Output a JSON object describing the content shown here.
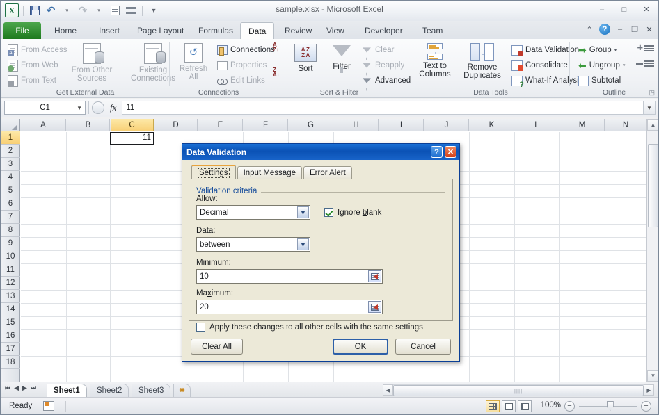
{
  "window": {
    "title": "sample.xlsx  -  Microsoft Excel",
    "minimize": "–",
    "restore": "□",
    "close": "✕"
  },
  "quick_access": {
    "logo": "X",
    "save": "save-icon",
    "undo": "↶",
    "redo": "↷",
    "customize": "▾"
  },
  "ribbon_tabs": [
    {
      "label": "File",
      "active": false,
      "file": true
    },
    {
      "label": "Home",
      "active": false
    },
    {
      "label": "Insert",
      "active": false
    },
    {
      "label": "Page Layout",
      "active": false
    },
    {
      "label": "Formulas",
      "active": false
    },
    {
      "label": "Data",
      "active": true
    },
    {
      "label": "Review",
      "active": false
    },
    {
      "label": "View",
      "active": false
    },
    {
      "label": "Developer",
      "active": false
    },
    {
      "label": "Team",
      "active": false
    }
  ],
  "ribbon_right": {
    "collapse": "⌃",
    "help": "?",
    "minimize": "–",
    "restore": "❐",
    "close": "✕"
  },
  "ribbon_groups": {
    "get_external_data": {
      "label": "Get External Data",
      "items": [
        "From Access",
        "From Web",
        "From Text",
        "From Other Sources",
        "Existing Connections"
      ]
    },
    "connections": {
      "label": "Connections",
      "refresh_all": "Refresh All",
      "items": [
        "Connections",
        "Properties",
        "Edit Links"
      ]
    },
    "sort_filter": {
      "label": "Sort & Filter",
      "sort": "Sort",
      "filter": "Filter",
      "items": [
        "Clear",
        "Reapply",
        "Advanced"
      ]
    },
    "data_tools": {
      "label": "Data Tools",
      "text_to_columns": "Text to Columns",
      "remove_duplicates": "Remove Duplicates",
      "items": [
        "Data Validation",
        "Consolidate",
        "What-If Analysis"
      ]
    },
    "outline": {
      "label": "Outline",
      "items": [
        "Group",
        "Ungroup",
        "Subtotal"
      ]
    }
  },
  "formula_bar": {
    "name_box": "C1",
    "fx": "fx",
    "value": "11"
  },
  "grid": {
    "columns": [
      "A",
      "B",
      "C",
      "D",
      "E",
      "F",
      "G",
      "H",
      "I",
      "J",
      "K",
      "L",
      "M",
      "N"
    ],
    "selected_column": "C",
    "rows": [
      "1",
      "2",
      "3",
      "4",
      "5",
      "6",
      "7",
      "8",
      "9",
      "10",
      "11",
      "12",
      "13",
      "14",
      "15",
      "16",
      "17",
      "18"
    ],
    "selected_row": "1",
    "active_cell": {
      "ref": "C1",
      "value": "11"
    }
  },
  "sheet_tabs": {
    "nav": [
      "⏮",
      "◀",
      "▶",
      "⏭"
    ],
    "tabs": [
      "Sheet1",
      "Sheet2",
      "Sheet3"
    ],
    "active": "Sheet1",
    "new_sheet": "new-sheet-icon"
  },
  "status_bar": {
    "mode": "Ready",
    "zoom": "100%",
    "zoom_out": "−",
    "zoom_in": "+",
    "views": [
      "normal-view",
      "page-layout-view",
      "page-break-view"
    ],
    "active_view": "normal-view"
  },
  "dialog": {
    "title": "Data Validation",
    "help_button": "?",
    "close_button": "✕",
    "tabs": [
      {
        "label": "Settings",
        "active": true
      },
      {
        "label": "Input Message",
        "active": false
      },
      {
        "label": "Error Alert",
        "active": false
      }
    ],
    "legend": "Validation criteria",
    "allow_label": "Allow:",
    "allow_value": "Decimal",
    "ignore_blank_label": "Ignore blank",
    "ignore_blank_checked": true,
    "data_label": "Data:",
    "data_value": "between",
    "minimum_label": "Minimum:",
    "minimum_value": "10",
    "maximum_label": "Maximum:",
    "maximum_value": "20",
    "apply_all_label": "Apply these changes to all other cells with the same settings",
    "apply_all_checked": false,
    "clear_all": "Clear All",
    "ok": "OK",
    "cancel": "Cancel"
  }
}
